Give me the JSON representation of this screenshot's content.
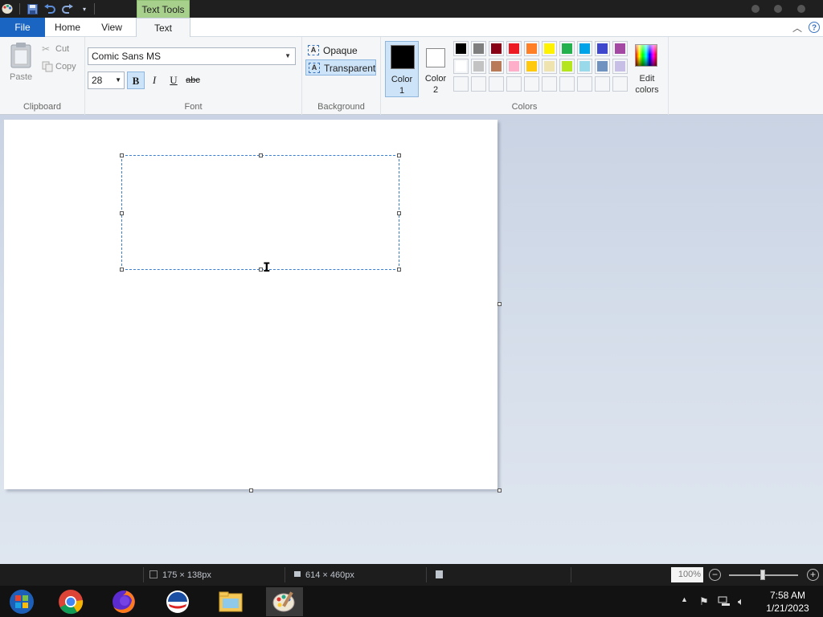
{
  "titlebar": {
    "contextual_tab": "Text Tools",
    "quick_access": [
      "paint-app-icon",
      "save-icon",
      "undo-icon",
      "redo-icon",
      "customize-dropdown-icon"
    ]
  },
  "tabs": {
    "file": "File",
    "home": "Home",
    "view": "View",
    "text": "Text"
  },
  "clipboard": {
    "paste": "Paste",
    "cut": "Cut",
    "copy": "Copy",
    "label": "Clipboard"
  },
  "font": {
    "family": "Comic Sans MS",
    "size": "28",
    "bold": "B",
    "italic": "I",
    "underline": "U",
    "strike": "abc",
    "label": "Font"
  },
  "background": {
    "opaque": "Opaque",
    "transparent": "Transparent",
    "label": "Background"
  },
  "colors": {
    "color1_label": "Color",
    "color1_num": "1",
    "color2_label": "Color",
    "color2_num": "2",
    "edit_label": "Edit",
    "edit_label2": "colors",
    "label": "Colors",
    "color1": "#000000",
    "color2": "#ffffff",
    "palette_row1": [
      "#000000",
      "#7f7f7f",
      "#880015",
      "#ed1c24",
      "#ff7f27",
      "#fff200",
      "#22b14c",
      "#00a2e8",
      "#3f48cc",
      "#a349a4"
    ],
    "palette_row2": [
      "#ffffff",
      "#c3c3c3",
      "#b97a57",
      "#ffaec9",
      "#ffc90e",
      "#efe4b0",
      "#b5e61d",
      "#99d9ea",
      "#7092be",
      "#c8bfe7"
    ],
    "palette_row3": [
      "",
      "",
      "",
      "",
      "",
      "",
      "",
      "",
      "",
      ""
    ]
  },
  "status": {
    "selection_size": "175 × 138px",
    "canvas_size": "614 × 460px",
    "zoom": "100%"
  },
  "taskbar": {
    "apps": [
      "start-orb-icon",
      "chrome-icon",
      "firefox-icon",
      "media-app-icon",
      "file-explorer-icon",
      "paint-icon"
    ],
    "time": "7:58 AM",
    "date": "1/21/2023"
  }
}
